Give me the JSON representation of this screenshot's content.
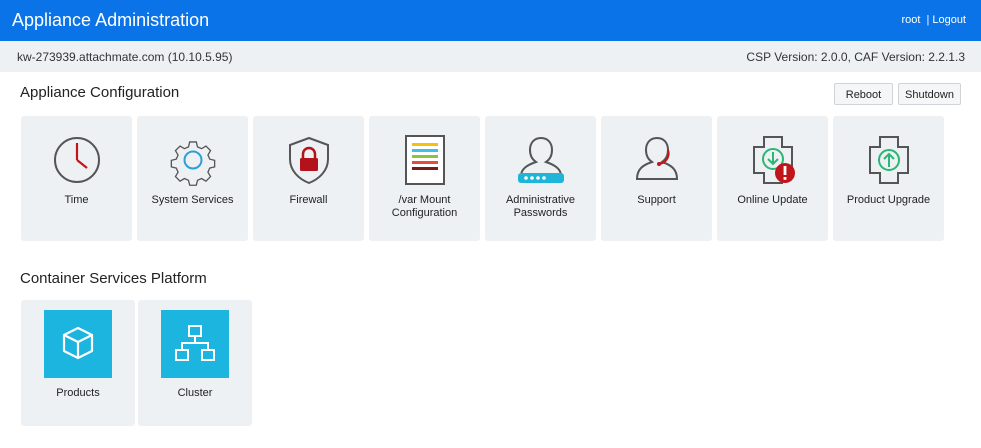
{
  "header": {
    "title": "Appliance Administration",
    "user": "root",
    "separator": "|",
    "logout": "Logout"
  },
  "info": {
    "host": "kw-273939.attachmate.com (10.10.5.95)",
    "versions": "CSP Version: 2.0.0, CAF Version: 2.2.1.3"
  },
  "appliance_config": {
    "title": "Appliance Configuration",
    "reboot": "Reboot",
    "shutdown": "Shutdown",
    "tiles": [
      {
        "label": "Time",
        "icon": "clock-icon"
      },
      {
        "label": "System Services",
        "icon": "gear-icon"
      },
      {
        "label": "Firewall",
        "icon": "shield-lock-icon"
      },
      {
        "label": "/var Mount Configuration",
        "icon": "document-icon"
      },
      {
        "label": "Administrative Passwords",
        "icon": "user-password-icon"
      },
      {
        "label": "Support",
        "icon": "headset-user-icon"
      },
      {
        "label": "Online Update",
        "icon": "update-alert-icon"
      },
      {
        "label": "Product Upgrade",
        "icon": "upgrade-icon"
      }
    ]
  },
  "csp": {
    "title": "Container Services Platform",
    "tiles": [
      {
        "label": "Products",
        "icon": "cube-icon"
      },
      {
        "label": "Cluster",
        "icon": "cluster-icon"
      }
    ]
  },
  "colors": {
    "topbar": "#0a73e8",
    "tile_bg": "#eef1f3",
    "csp_icon_bg": "#1cb5e0",
    "alert_red": "#d0021b",
    "update_green": "#2bb673"
  }
}
